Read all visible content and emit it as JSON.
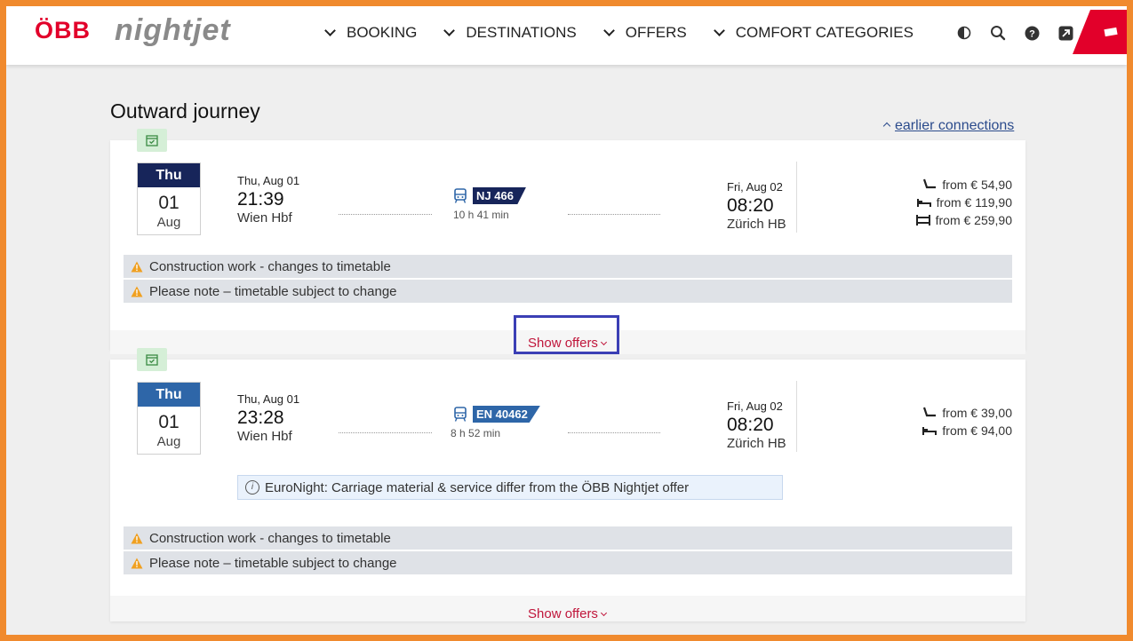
{
  "header": {
    "logo_brand": "ÖBB",
    "logo_product": "nightjet",
    "nav": [
      {
        "label": "BOOKING"
      },
      {
        "label": "DESTINATIONS"
      },
      {
        "label": "OFFERS"
      },
      {
        "label": "COMFORT CATEGORIES"
      }
    ],
    "icons": [
      "contrast-icon",
      "search-icon",
      "help-icon",
      "external-link-icon",
      "ticket-icon"
    ]
  },
  "page": {
    "title": "Outward journey",
    "earlier_connections": "earlier connections"
  },
  "connections": [
    {
      "dow": "Thu",
      "day": "01",
      "month": "Aug",
      "dep_date": "Thu, Aug 01",
      "dep_time": "21:39",
      "dep_station": "Wien Hbf",
      "train": "NJ 466",
      "duration": "10 h 41 min",
      "arr_date": "Fri, Aug 02",
      "arr_time": "08:20",
      "arr_station": "Zürich HB",
      "prices": [
        {
          "category": "seat",
          "label": "from € 54,90"
        },
        {
          "category": "couchette",
          "label": "from € 119,90"
        },
        {
          "category": "sleeper",
          "label": "from € 259,90"
        }
      ],
      "notices": [
        "Construction work - changes to timetable",
        "Please note – timetable subject to change"
      ],
      "show_offers": "Show offers"
    },
    {
      "dow": "Thu",
      "day": "01",
      "month": "Aug",
      "dep_date": "Thu, Aug 01",
      "dep_time": "23:28",
      "dep_station": "Wien Hbf",
      "train": "EN 40462",
      "duration": "8 h 52 min",
      "arr_date": "Fri, Aug 02",
      "arr_time": "08:20",
      "arr_station": "Zürich HB",
      "prices": [
        {
          "category": "seat",
          "label": "from € 39,00"
        },
        {
          "category": "couchette",
          "label": "from € 94,00"
        }
      ],
      "info": "EuroNight: Carriage material & service differ from the ÖBB Nightjet offer",
      "notices": [
        "Construction work - changes to timetable",
        "Please note – timetable subject to change"
      ],
      "show_offers": "Show offers"
    }
  ],
  "colors": {
    "brand_red": "#e2002a",
    "nightjet_navy": "#17255a",
    "euronight_blue": "#2e66a8",
    "offer_link": "#c0163b",
    "frame_orange": "#f08a2e"
  }
}
